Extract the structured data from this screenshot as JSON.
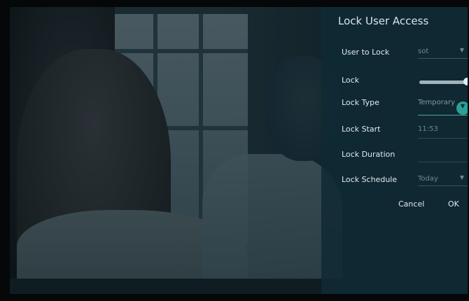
{
  "panel": {
    "title": "Lock User Access",
    "rows": [
      {
        "label": "User to Lock",
        "value": "sot"
      },
      {
        "label": "Lock",
        "value": ""
      },
      {
        "label": "Lock Type",
        "value": "Temporary"
      },
      {
        "label": "Lock Start",
        "value": "11:53"
      },
      {
        "label": "Lock Duration",
        "value": ""
      },
      {
        "label": "Lock Schedule",
        "value": "Today"
      }
    ],
    "buttons": {
      "cancel": "Cancel",
      "ok": "OK"
    }
  },
  "colors": {
    "accent": "#2aa097",
    "panel_bg": "#0f2a34"
  }
}
